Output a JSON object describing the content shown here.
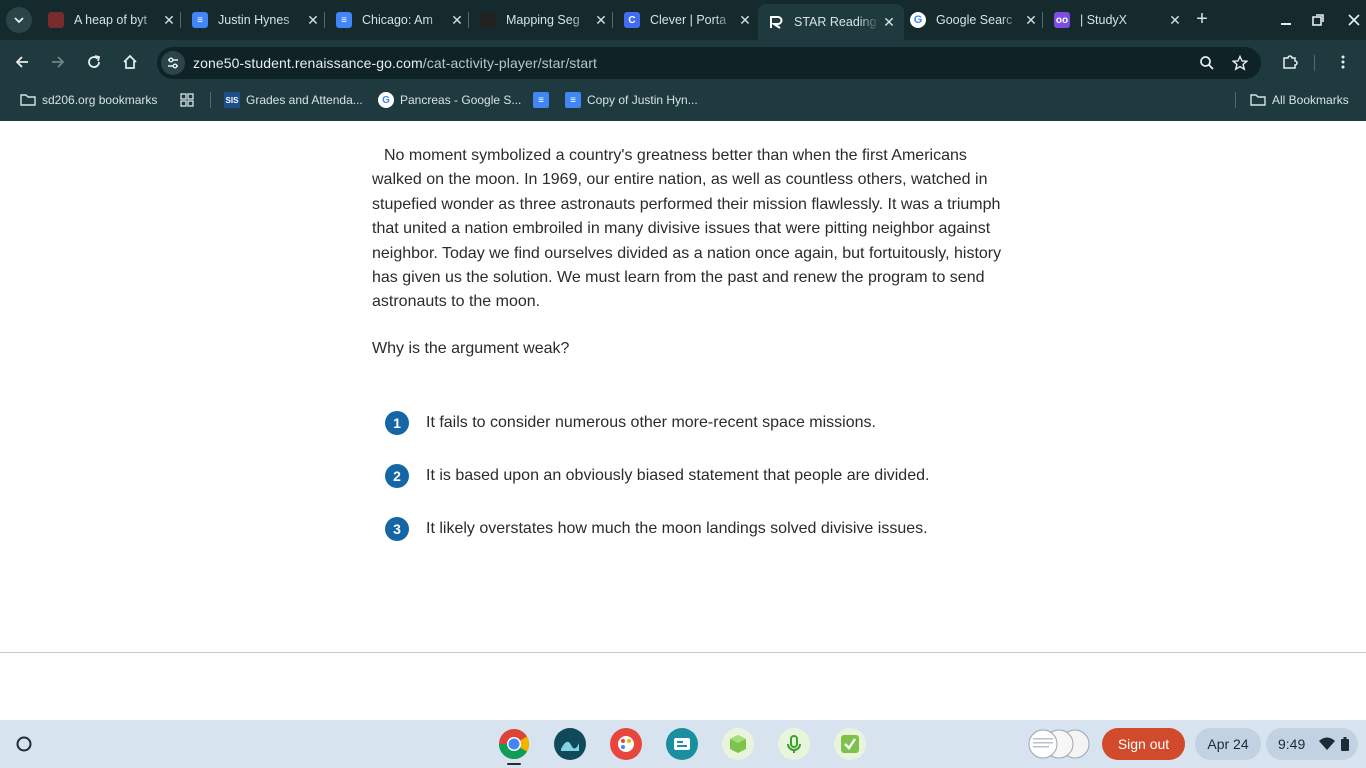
{
  "browser": {
    "tabs": [
      {
        "title": "A heap of byt",
        "favicon": "pixel-art-icon",
        "color": "#7a2b2b"
      },
      {
        "title": "Justin Hynes",
        "favicon": "google-docs-icon",
        "color": "#4285f4"
      },
      {
        "title": "Chicago: Am",
        "favicon": "google-docs-icon",
        "color": "#4285f4"
      },
      {
        "title": "Mapping Seg",
        "favicon": "dark-logo-icon",
        "color": "#222222"
      },
      {
        "title": "Clever | Porta",
        "favicon": "clever-icon",
        "color": "#436cf2"
      },
      {
        "title": "STAR Reading",
        "favicon": "renaissance-icon",
        "color": "#ffffff"
      },
      {
        "title": "Google Searc",
        "favicon": "google-icon",
        "color": "#ffffff"
      },
      {
        "title": "| StudyX",
        "favicon": "studyx-icon",
        "color": "#7b4ee0"
      }
    ],
    "active_tab_index": 5,
    "url_host": "zone50-student.renaissance-go.com",
    "url_path": "/cat-activity-player/star/start",
    "bookmarks": [
      {
        "label": "sd206.org bookmarks",
        "icon": "managed-folder-icon"
      },
      {
        "label": "",
        "icon": "apps-grid-icon"
      },
      {
        "label": "Grades and Attenda...",
        "icon": "sis-icon"
      },
      {
        "label": "Pancreas - Google S...",
        "icon": "google-icon"
      },
      {
        "label": "",
        "icon": "google-docs-icon"
      },
      {
        "label": "Copy of Justin Hyn...",
        "icon": "google-docs-icon"
      }
    ],
    "all_bookmarks_label": "All Bookmarks"
  },
  "question": {
    "passage": "No moment symbolized a country's greatness better than when the first Americans walked on the moon. In 1969, our entire nation, as well as countless others, watched in stupefied wonder as three astronauts performed their mission flawlessly. It was a triumph that united a nation embroiled in many divisive issues that were pitting neighbor against neighbor. Today we find ourselves divided as a nation once again, but fortuitously, history has given us the solution. We must learn from the past and renew the program to send astronauts to the moon.",
    "prompt": "Why is the argument weak?",
    "options": [
      {
        "number": "1",
        "text": "It fails to consider numerous other more-recent space missions."
      },
      {
        "number": "2",
        "text": "It is based upon an obviously biased statement that people are divided."
      },
      {
        "number": "3",
        "text": "It likely overstates how much the moon landings solved divisive issues."
      }
    ],
    "option_color": "#1466a6"
  },
  "shelf": {
    "apps": [
      "chrome-icon",
      "lab-app-icon",
      "paint-app-icon",
      "classroom-app-icon",
      "cube-app-icon",
      "mic-app-icon",
      "check-app-icon"
    ],
    "sign_out_label": "Sign out",
    "date": "Apr 24",
    "time": "9:49"
  }
}
